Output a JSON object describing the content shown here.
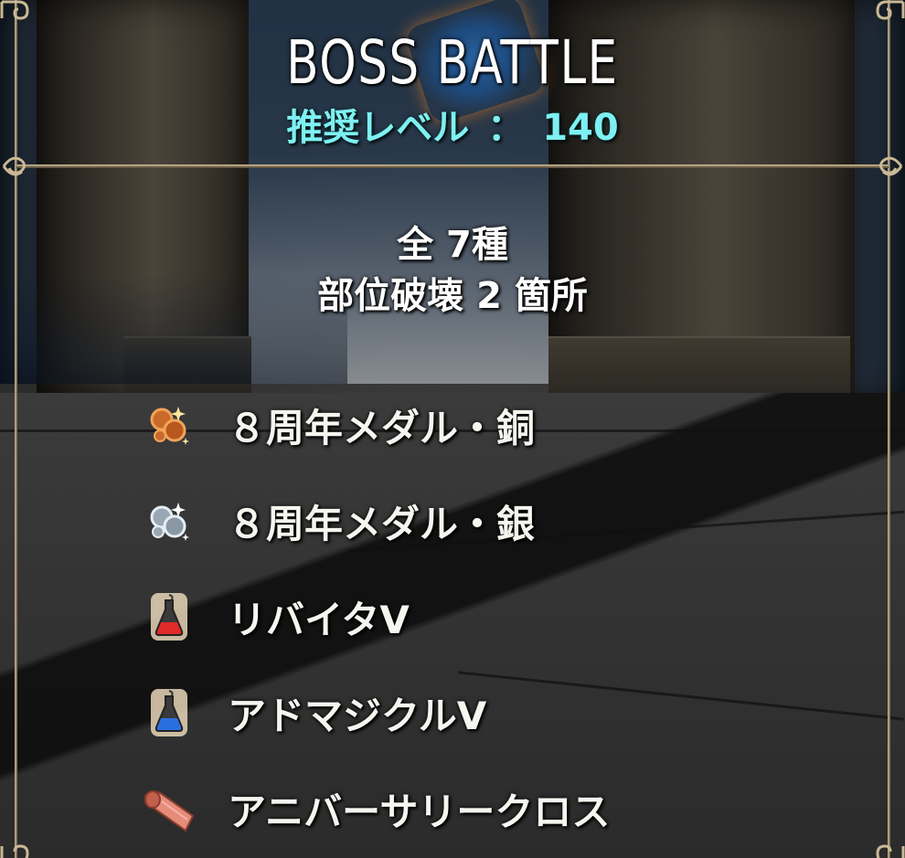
{
  "header": {
    "title": "BOSS BATTLE",
    "recommended_level_label": "推奨レベル",
    "separator": "：",
    "recommended_level_value": "140"
  },
  "summary": {
    "total_line": "全 7種",
    "parts_line": "部位破壊 2 箇所"
  },
  "drops": [
    {
      "label": "８周年メダル・銅",
      "icon": "bronze-medal-icon"
    },
    {
      "label": "８周年メダル・銀",
      "icon": "silver-medal-icon"
    },
    {
      "label": "リバイタV",
      "icon": "red-potion-icon"
    },
    {
      "label": "アドマジクルV",
      "icon": "blue-potion-icon"
    },
    {
      "label": "アニバーサリークロス",
      "icon": "cloth-icon"
    }
  ],
  "colors": {
    "level_text": "#7ef0f2",
    "frame_gold": "#cbb894",
    "text_white": "#f7f5ef"
  }
}
